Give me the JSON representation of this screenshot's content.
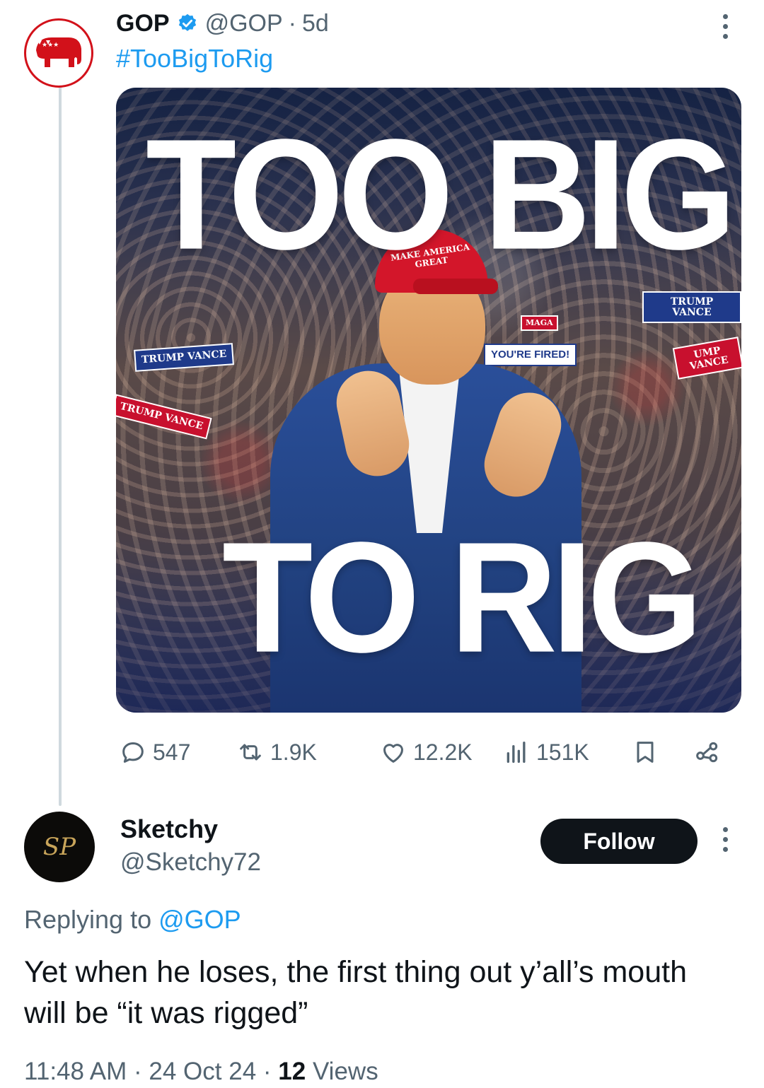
{
  "post": {
    "author_name": "GOP",
    "handle": "@GOP",
    "separator": "·",
    "age": "5d",
    "text": "#TooBigToRig",
    "image": {
      "headline_top": "TOO BIG",
      "headline_bottom": "TO RIG",
      "cap_text": "MAKE AMERICA GREAT",
      "signs": [
        "TRUMP VANCE",
        "TRUMP VANCE",
        "TRUMP VANCE",
        "YOU'RE FIRED!",
        "MAGA",
        "TRUMP",
        "UMP VANCE"
      ]
    },
    "stats": {
      "replies": "547",
      "reposts": "1.9K",
      "likes": "12.2K",
      "views": "151K"
    }
  },
  "reply": {
    "author_name": "Sketchy",
    "handle": "@Sketchy72",
    "avatar_monogram": "SP",
    "follow_label": "Follow",
    "replying_prefix": "Replying to",
    "replying_to": "@GOP",
    "text": "Yet when he loses, the first thing out y’all’s mouth will be “it was rigged”",
    "time": "11:48 AM",
    "date": "24 Oct 24",
    "views_count": "12",
    "views_label": "Views"
  },
  "colors": {
    "accent": "#1d9bf0",
    "text": "#0f1419",
    "muted": "#536471",
    "gop_red": "#d2111a"
  },
  "icons": [
    "gop-elephant-icon",
    "verified-badge-icon",
    "more-icon",
    "reply-icon",
    "repost-icon",
    "like-icon",
    "views-icon",
    "bookmark-icon",
    "share-icon"
  ]
}
